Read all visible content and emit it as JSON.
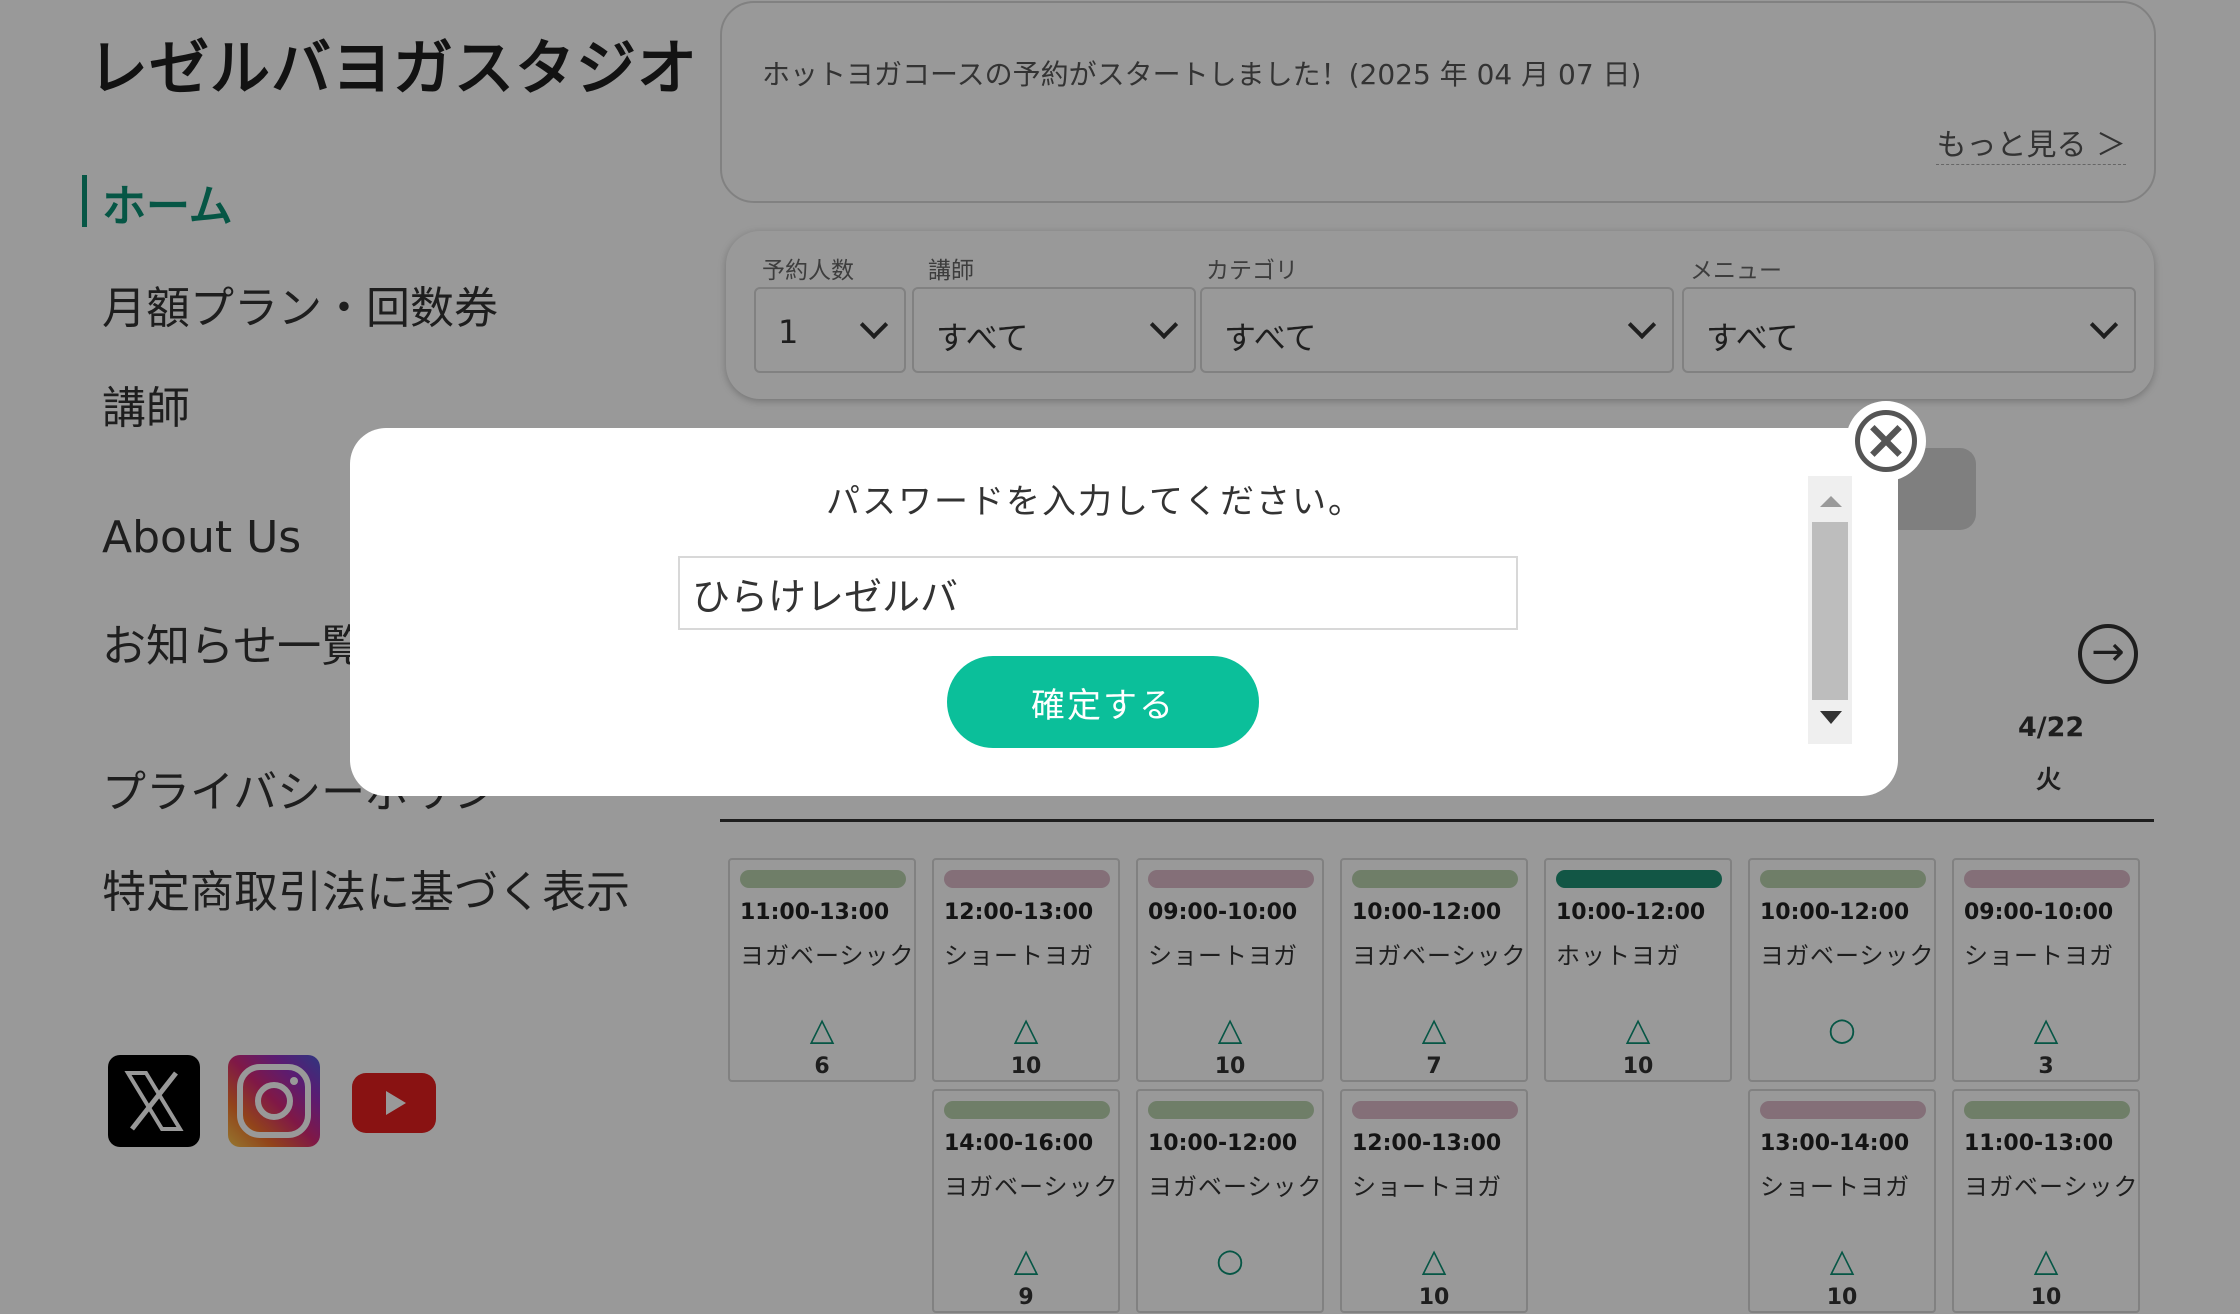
{
  "brand": "レゼルバヨガスタジオ",
  "nav": {
    "items": [
      "ホーム",
      "月額プラン・回数券",
      "講師",
      "About Us",
      "お知らせ一覧",
      "プライバシーポリシー",
      "特定商取引法に基づく表示"
    ],
    "active": "ホーム"
  },
  "social": [
    "x-icon",
    "instagram-icon",
    "youtube-icon"
  ],
  "news": {
    "text": "ホットヨガコースの予約がスタートしました！(2025 年 04 月 07 日)",
    "more": "もっと見る ＞"
  },
  "filters": {
    "people": {
      "label": "予約人数",
      "value": "1"
    },
    "instructor": {
      "label": "講師",
      "value": "すべて"
    },
    "category": {
      "label": "カテゴリ",
      "value": "すべて"
    },
    "menu": {
      "label": "メニュー",
      "value": "すべて"
    }
  },
  "calendar": {
    "visible_date": "4/22",
    "visible_dow": "火",
    "slots": [
      {
        "time": "11:00-13:00",
        "name": "ヨガベーシック",
        "mark": "△",
        "count": "6",
        "tag": "basic"
      },
      {
        "time": "12:00-13:00",
        "name": "ショートヨガ",
        "mark": "△",
        "count": "10",
        "tag": "short"
      },
      {
        "time": "09:00-10:00",
        "name": "ショートヨガ",
        "mark": "△",
        "count": "10",
        "tag": "short"
      },
      {
        "time": "10:00-12:00",
        "name": "ヨガベーシック",
        "mark": "△",
        "count": "7",
        "tag": "basic"
      },
      {
        "time": "10:00-12:00",
        "name": "ホットヨガ",
        "mark": "△",
        "count": "10",
        "tag": "hot"
      },
      {
        "time": "10:00-12:00",
        "name": "ヨガベーシック",
        "mark": "○",
        "count": "",
        "tag": "basic"
      },
      {
        "time": "09:00-10:00",
        "name": "ショートヨガ",
        "mark": "△",
        "count": "3",
        "tag": "short"
      },
      {
        "time": "14:00-16:00",
        "name": "ヨガベーシック",
        "mark": "△",
        "count": "9",
        "tag": "basic"
      },
      {
        "time": "10:00-12:00",
        "name": "ヨガベーシック",
        "mark": "○",
        "count": "",
        "tag": "basic"
      },
      {
        "time": "12:00-13:00",
        "name": "ショートヨガ",
        "mark": "△",
        "count": "10",
        "tag": "short"
      },
      {
        "time": "13:00-14:00",
        "name": "ショートヨガ",
        "mark": "△",
        "count": "10",
        "tag": "short"
      },
      {
        "time": "11:00-13:00",
        "name": "ヨガベーシック",
        "mark": "△",
        "count": "10",
        "tag": "basic"
      }
    ]
  },
  "modal": {
    "title": "パスワードを入力してください。",
    "input_value": "ひらけレゼルバ",
    "submit_label": "確定する"
  },
  "colors": {
    "accent": "#0b8f73",
    "button": "#0bbf9a",
    "tag_basic": "#b9d3ae",
    "tag_short": "#dcb9c9",
    "tag_hot": "#1f8f73"
  }
}
